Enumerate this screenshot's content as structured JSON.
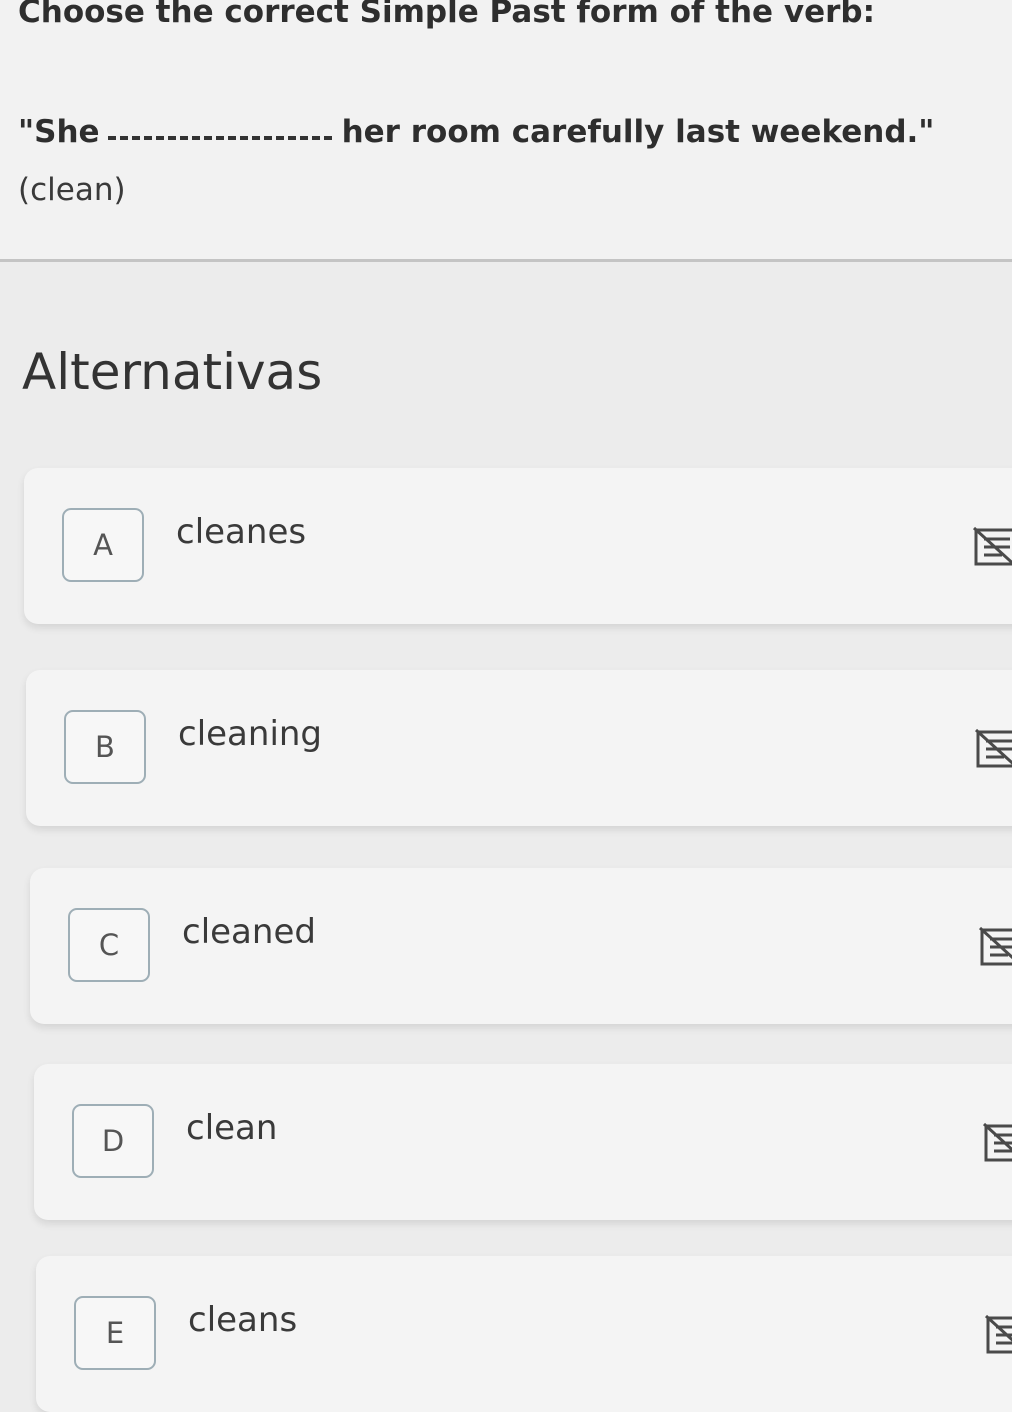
{
  "question": {
    "title": "Choose the correct Simple Past form of the verb:",
    "sentence_start": "\"She",
    "sentence_end": "her room carefully last weekend.\"",
    "hint": "(clean)"
  },
  "alternatives": {
    "heading": "Alternativas",
    "options": [
      {
        "letter": "A",
        "text": "cleanes",
        "icon": "strikethrough-icon"
      },
      {
        "letter": "B",
        "text": "cleaning",
        "icon": "strikethrough-icon"
      },
      {
        "letter": "C",
        "text": "cleaned",
        "icon": "strikethrough-icon"
      },
      {
        "letter": "D",
        "text": "clean",
        "icon": "strikethrough-icon"
      },
      {
        "letter": "E",
        "text": "cleans",
        "icon": "strikethrough-icon"
      }
    ]
  },
  "colors": {
    "background": "#ececec",
    "card": "#f4f4f4",
    "letter_border": "#9eaeb6",
    "text": "#333333"
  }
}
